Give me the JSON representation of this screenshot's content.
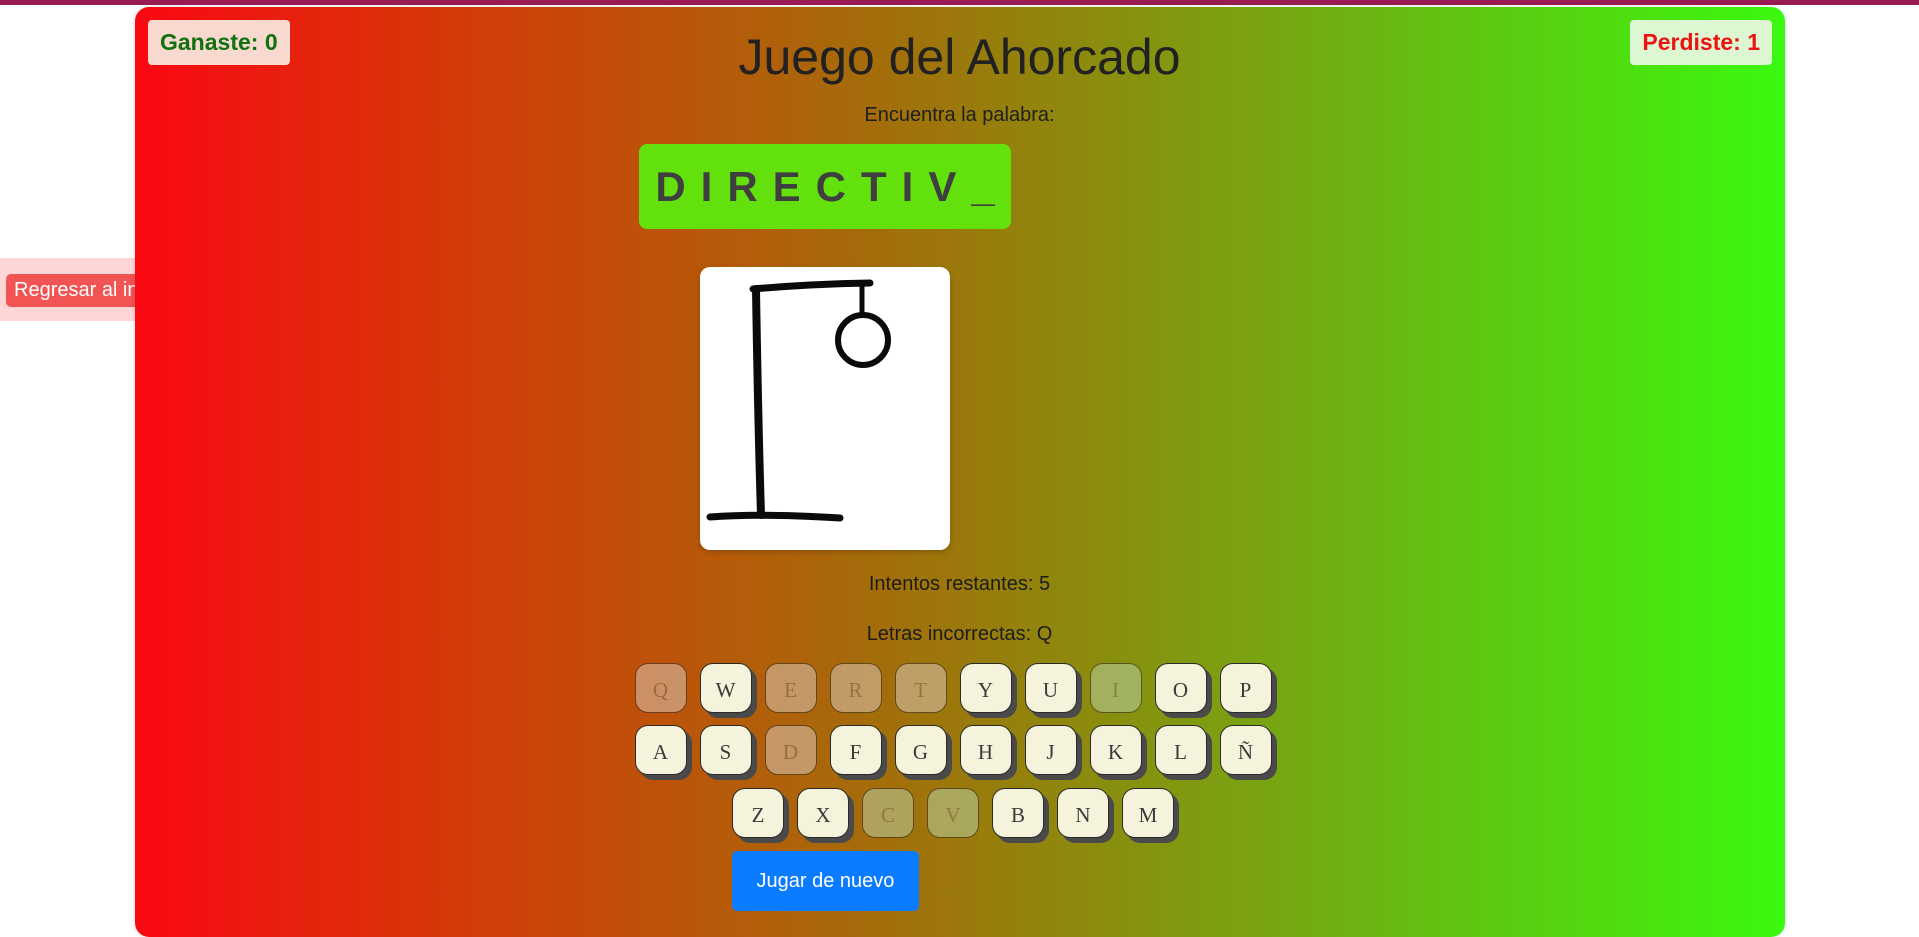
{
  "scores": {
    "win_label": "Ganaste: 0",
    "lose_label": "Perdiste: 1"
  },
  "header": {
    "title": "Juego del Ahorcado",
    "prompt": "Encuentra la palabra:"
  },
  "word": {
    "display": "DIRECTIV_"
  },
  "status": {
    "attempts_text": "Intentos restantes: 5",
    "wrong_letters_text": "Letras incorrectas: Q"
  },
  "keyboard": {
    "rows": [
      [
        {
          "letter": "Q",
          "state": "wrong"
        },
        {
          "letter": "W",
          "state": "available"
        },
        {
          "letter": "E",
          "state": "used"
        },
        {
          "letter": "R",
          "state": "used"
        },
        {
          "letter": "T",
          "state": "used"
        },
        {
          "letter": "Y",
          "state": "available"
        },
        {
          "letter": "U",
          "state": "available"
        },
        {
          "letter": "I",
          "state": "used-green"
        },
        {
          "letter": "O",
          "state": "available"
        },
        {
          "letter": "P",
          "state": "available"
        }
      ],
      [
        {
          "letter": "A",
          "state": "available"
        },
        {
          "letter": "S",
          "state": "available"
        },
        {
          "letter": "D",
          "state": "used"
        },
        {
          "letter": "F",
          "state": "available"
        },
        {
          "letter": "G",
          "state": "available"
        },
        {
          "letter": "H",
          "state": "available"
        },
        {
          "letter": "J",
          "state": "available"
        },
        {
          "letter": "K",
          "state": "available"
        },
        {
          "letter": "L",
          "state": "available"
        },
        {
          "letter": "Ñ",
          "state": "available"
        }
      ],
      [
        {
          "letter": "Z",
          "state": "available"
        },
        {
          "letter": "X",
          "state": "available"
        },
        {
          "letter": "C",
          "state": "used-green"
        },
        {
          "letter": "V",
          "state": "used-green"
        },
        {
          "letter": "B",
          "state": "available"
        },
        {
          "letter": "N",
          "state": "available"
        },
        {
          "letter": "M",
          "state": "available"
        }
      ]
    ]
  },
  "buttons": {
    "play_again": "Jugar de nuevo",
    "home": "Regresar al inicio"
  },
  "colors": {
    "gradient_start": "#fa0812",
    "gradient_end": "#3af90f",
    "word_box": "#62e10d",
    "play_again": "#0b7bff",
    "home_button": "#f25353"
  },
  "icons": {
    "gallows": "hangman-gallows-icon"
  }
}
